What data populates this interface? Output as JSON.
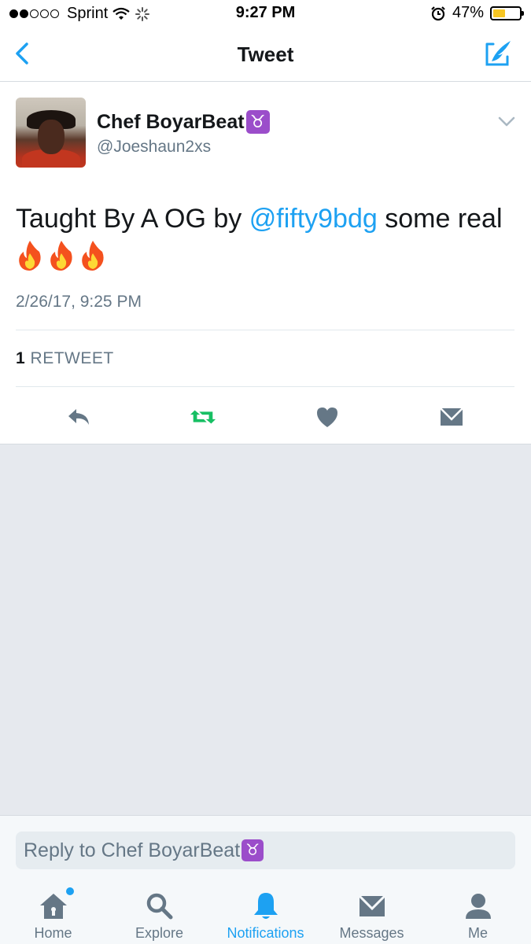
{
  "status_bar": {
    "carrier": "Sprint",
    "time": "9:27 PM",
    "battery": "47%",
    "battery_level": 0.47,
    "signal_bars_filled": 2,
    "signal_bars_total": 5
  },
  "nav": {
    "title": "Tweet",
    "back_icon": "chevron-left-icon",
    "compose_icon": "compose-icon",
    "accent_color": "#1da1f2"
  },
  "tweet": {
    "user_name": "Chef BoyarBeat",
    "user_name_emoji": "♉",
    "handle": "@Joeshaun2xs",
    "text_before": "Taught By A OG by ",
    "mention": "@fifty9bdg",
    "text_after": " some real",
    "emoji": [
      "fire",
      "fire",
      "fire"
    ],
    "timestamp": "2/26/17, 9:25 PM",
    "retweet_count": "1",
    "retweet_label": "RETWEET"
  },
  "actions": [
    {
      "name": "reply",
      "icon": "reply-icon",
      "color": "#657786"
    },
    {
      "name": "retweet",
      "icon": "retweet-icon",
      "color": "#17bf63"
    },
    {
      "name": "like",
      "icon": "heart-icon",
      "color": "#657786"
    },
    {
      "name": "direct-message",
      "icon": "envelope-icon",
      "color": "#657786"
    }
  ],
  "reply_bar": {
    "placeholder": "Reply to Chef BoyarBeat",
    "placeholder_emoji": "♉"
  },
  "tabs": [
    {
      "label": "Home",
      "icon": "home-icon",
      "active": false,
      "has_badge": true
    },
    {
      "label": "Explore",
      "icon": "search-icon",
      "active": false
    },
    {
      "label": "Notifications",
      "icon": "bell-icon",
      "active": true
    },
    {
      "label": "Messages",
      "icon": "envelope-icon",
      "active": false
    },
    {
      "label": "Me",
      "icon": "person-icon",
      "active": false
    }
  ]
}
